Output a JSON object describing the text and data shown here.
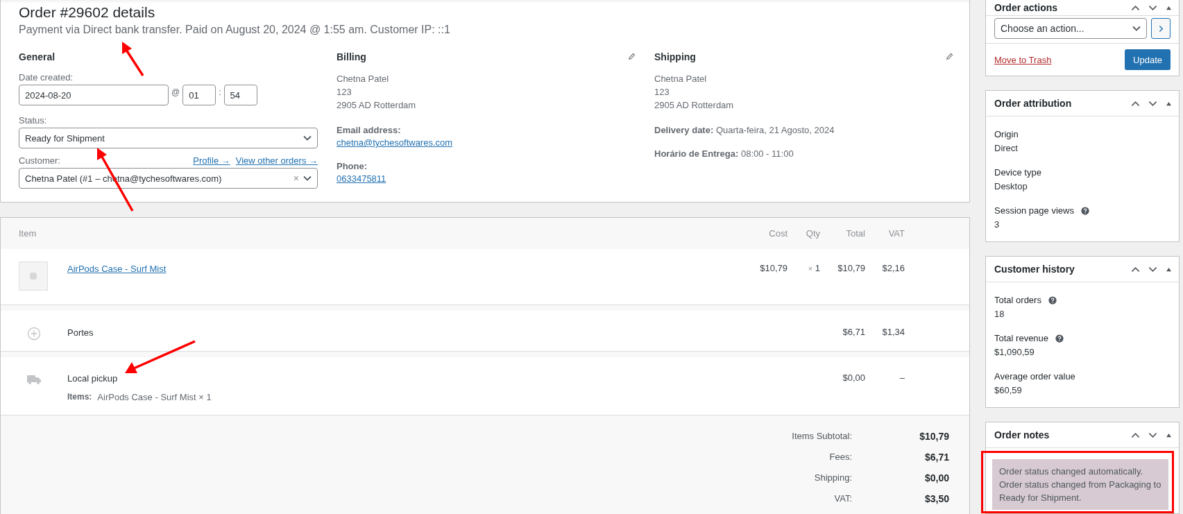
{
  "header": {
    "title": "Order #29602 details",
    "subtitle": "Payment via Direct bank transfer. Paid on August 20, 2024 @ 1:55 am. Customer IP: ::1"
  },
  "general": {
    "heading": "General",
    "date_label": "Date created:",
    "date": "2024-08-20",
    "at": "@",
    "hour": "01",
    "colon": ":",
    "minute": "54",
    "status_label": "Status:",
    "status": "Ready for Shipment",
    "customer_label": "Customer:",
    "profile_link": "Profile →",
    "orders_link": "View other orders →",
    "customer": "Chetna Patel (#1 – chetna@tychesoftwares.com)",
    "clear": "×"
  },
  "addresses": [
    {
      "heading": "Billing",
      "lines": [
        "Chetna Patel",
        "123",
        "2905 AD Rotterdam"
      ],
      "fields": [
        {
          "kind": "link",
          "label": "Email address:",
          "value": "chetna@tychesoftwares.com"
        },
        {
          "kind": "link",
          "label": "Phone:",
          "value": "0633475811"
        }
      ]
    },
    {
      "heading": "Shipping",
      "lines": [
        "Chetna Patel",
        "123",
        "2905 AD Rotterdam"
      ],
      "fields": [
        {
          "kind": "inline",
          "label": "Delivery date:",
          "value": "Quarta-feira, 21 Agosto, 2024"
        },
        {
          "kind": "inline",
          "label": "Horário de Entrega:",
          "value": "08:00 - 11:00"
        }
      ]
    }
  ],
  "items": {
    "columns": [
      "Item",
      "Cost",
      "Qty",
      "Total",
      "VAT"
    ],
    "rows": [
      {
        "kind": "product",
        "name": "AirPods Case - Surf Mist",
        "cost": "$10,79",
        "qty_sign": "×",
        "qty": "1",
        "total": "$10,79",
        "vat": "$2,16"
      },
      {
        "kind": "fee",
        "name": "Portes",
        "total": "$6,71",
        "vat": "$1,34"
      },
      {
        "kind": "shipping",
        "name": "Local pickup",
        "items_label": "Items:",
        "items": "AirPods Case - Surf Mist × 1",
        "total": "$0,00",
        "vat": "–"
      }
    ],
    "totals": [
      {
        "label": "Items Subtotal:",
        "value": "$10,79"
      },
      {
        "label": "Fees:",
        "value": "$6,71"
      },
      {
        "label": "Shipping:",
        "value": "$0,00"
      },
      {
        "label": "VAT:",
        "value": "$3,50"
      }
    ]
  },
  "sidebar": [
    {
      "kind": "actions",
      "title": "Order actions",
      "select": "Choose an action...",
      "trash": "Move to Trash",
      "update": "Update"
    },
    {
      "kind": "fields",
      "title": "Order attribution",
      "fields": [
        {
          "label": "Origin",
          "value": "Direct",
          "help": false
        },
        {
          "label": "Device type",
          "value": "Desktop",
          "help": false
        },
        {
          "label": "Session page views",
          "value": "3",
          "help": true
        }
      ]
    },
    {
      "kind": "fields",
      "title": "Customer history",
      "fields": [
        {
          "label": "Total orders",
          "value": "18",
          "help": true
        },
        {
          "label": "Total revenue",
          "value": "$1,090,59",
          "help": true
        },
        {
          "label": "Average order value",
          "value": "$60,59",
          "help": false
        }
      ]
    },
    {
      "kind": "notes",
      "title": "Order notes",
      "notes": [
        "Order status changed automatically.\nOrder status changed from Packaging to\nReady for Shipment."
      ]
    }
  ]
}
